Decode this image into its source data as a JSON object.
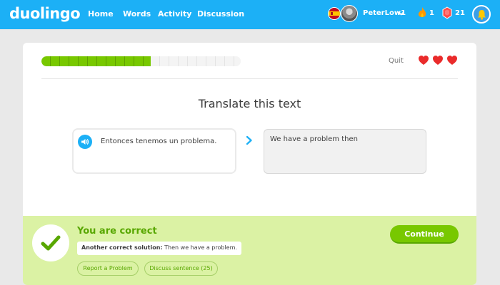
{
  "nav": {
    "logo": "duolingo",
    "links": [
      "Home",
      "Words",
      "Activity",
      "Discussion"
    ],
    "username": "PeterLow1",
    "streak": "1",
    "gems": "21",
    "icons": [
      "spain-flag-icon",
      "avatar",
      "chevron-down-icon",
      "flame-icon",
      "gem-icon",
      "bell-icon"
    ]
  },
  "lesson": {
    "progress_fraction": 0.55,
    "quit_label": "Quit",
    "hearts": 3,
    "title": "Translate this text",
    "source_text": "Entonces tenemos un problema.",
    "answer_text": "We have a problem then"
  },
  "feedback": {
    "status": "You are correct",
    "solution_label": "Another correct solution:",
    "solution_text": "Then we have a problem.",
    "report_label": "Report a Problem",
    "discuss_label": "Discuss sentence (25)",
    "continue_label": "Continue"
  },
  "colors": {
    "nav_blue": "#1cb0f6",
    "success_green": "#78c800",
    "feedback_bg": "#dbf2a4",
    "heart_red": "#ea2b2b"
  }
}
